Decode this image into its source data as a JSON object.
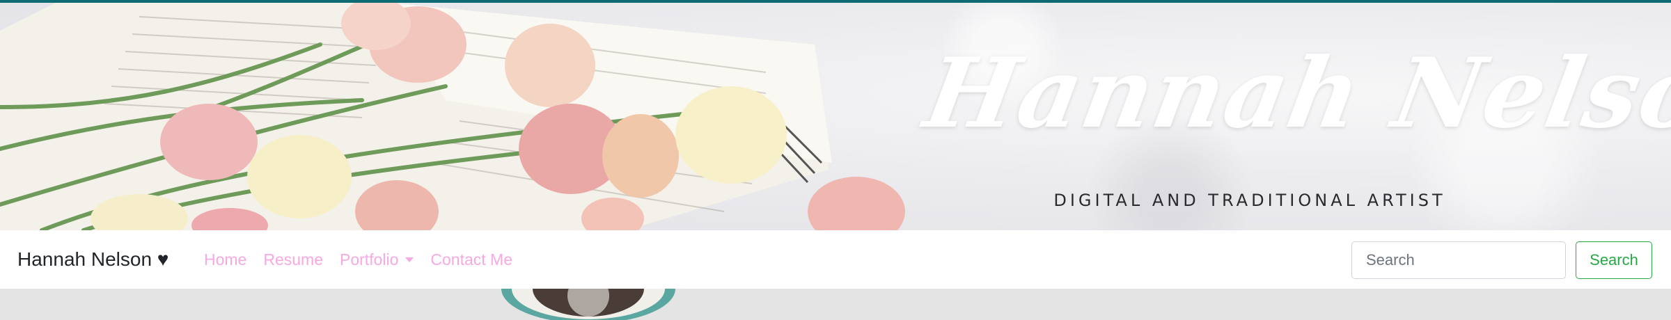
{
  "banner": {
    "title": "Hannah Nelson",
    "subtitle": "DIGITAL AND TRADITIONAL ARTIST"
  },
  "navbar": {
    "brand": "Hannah Nelson ♥",
    "links": [
      {
        "label": "Home"
      },
      {
        "label": "Resume"
      },
      {
        "label": "Portfolio"
      },
      {
        "label": "Contact Me"
      }
    ],
    "search_placeholder": "Search",
    "search_button": "Search"
  },
  "colors": {
    "accent_top": "#0d6b73",
    "nav_link": "#f6a9e3",
    "search_button": "#28a745"
  }
}
